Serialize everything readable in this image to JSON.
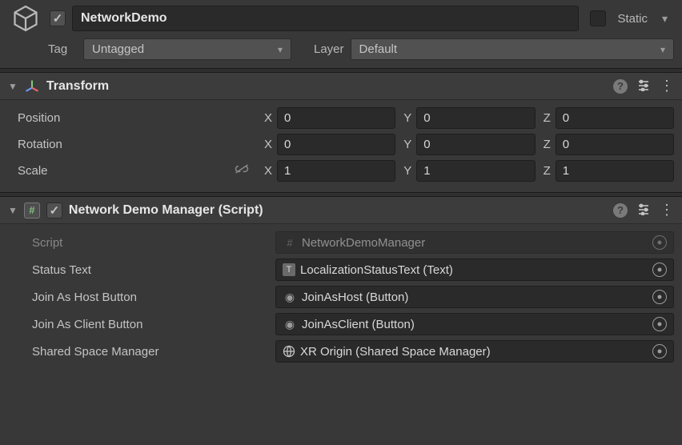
{
  "header": {
    "object_enabled_checked": true,
    "name": "NetworkDemo",
    "static_checked": false,
    "static_label": "Static"
  },
  "tag_row": {
    "tag_label": "Tag",
    "tag_value": "Untagged",
    "layer_label": "Layer",
    "layer_value": "Default"
  },
  "transform": {
    "title": "Transform",
    "position_label": "Position",
    "rotation_label": "Rotation",
    "scale_label": "Scale",
    "x_label": "X",
    "y_label": "Y",
    "z_label": "Z",
    "position": {
      "x": "0",
      "y": "0",
      "z": "0"
    },
    "rotation": {
      "x": "0",
      "y": "0",
      "z": "0"
    },
    "scale": {
      "x": "1",
      "y": "1",
      "z": "1"
    }
  },
  "network_demo_manager": {
    "enabled_checked": true,
    "title": "Network Demo Manager (Script)",
    "script_label": "Script",
    "script_value": "NetworkDemoManager",
    "status_text_label": "Status Text",
    "status_text_value": "LocalizationStatusText (Text)",
    "join_host_label": "Join As Host Button",
    "join_host_value": "JoinAsHost (Button)",
    "join_client_label": "Join As Client Button",
    "join_client_value": "JoinAsClient (Button)",
    "shared_space_label": "Shared Space Manager",
    "shared_space_value": "XR Origin (Shared Space Manager)"
  }
}
